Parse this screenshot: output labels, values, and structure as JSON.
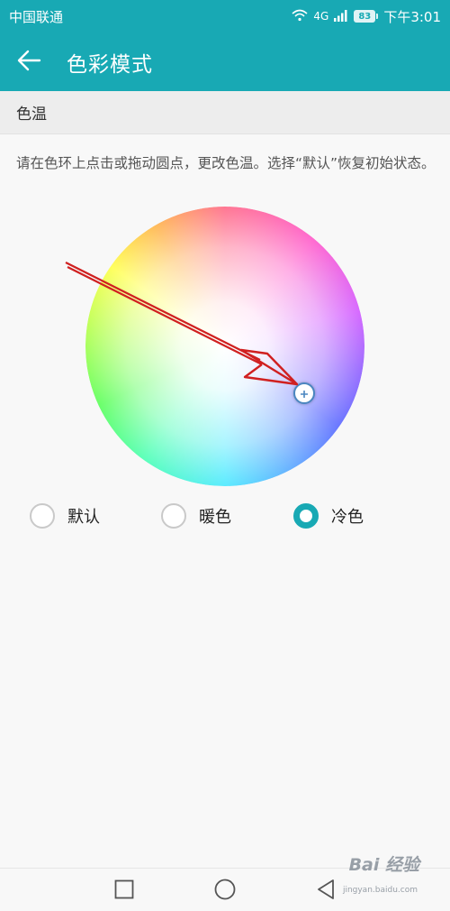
{
  "status_bar": {
    "carrier": "中国联通",
    "network": "4G",
    "battery": "83",
    "time": "下午3:01"
  },
  "app_bar": {
    "title": "色彩模式",
    "back_icon": "arrow-left-icon"
  },
  "section": {
    "header": "色温",
    "description": "请在色环上点击或拖动圆点，更改色温。选择“默认”恢复初始状态。"
  },
  "color_wheel": {
    "handle_icon": "plus-icon"
  },
  "options": [
    {
      "label": "默认",
      "checked": false
    },
    {
      "label": "暖色",
      "checked": false
    },
    {
      "label": "冷色",
      "checked": true
    }
  ],
  "nav": {
    "recents_icon": "square-icon",
    "home_icon": "circle-icon",
    "back_icon": "triangle-back-icon"
  },
  "watermark": {
    "brand": "Bai 经验",
    "url": "jingyan.baidu.com"
  },
  "colors": {
    "accent": "#18a9b4",
    "annotation_arrow": "#d02020"
  }
}
